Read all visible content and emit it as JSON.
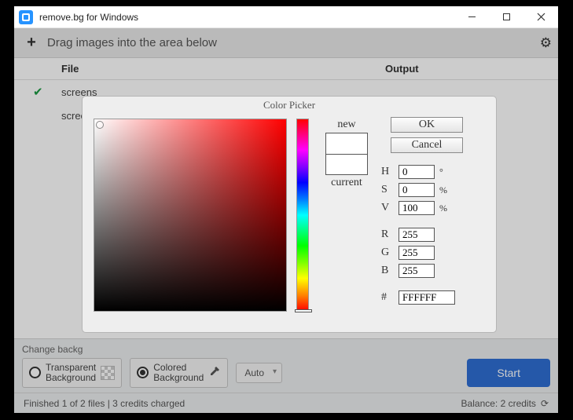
{
  "titlebar": {
    "title": "remove.bg for Windows"
  },
  "toolbar": {
    "drag_hint": "Drag images into the area below"
  },
  "columns": {
    "file": "File",
    "output": "Output"
  },
  "rows": [
    {
      "status": "done",
      "file": "screens"
    },
    {
      "status": "",
      "file": "screens"
    }
  ],
  "bottom": {
    "change_label": "Change backg",
    "transparent": "Transparent\nBackground",
    "colored": "Colored\nBackground",
    "size": "Auto",
    "start": "Start"
  },
  "status": {
    "left": "Finished 1 of 2 files | 3 credits charged",
    "right": "Balance: 2 credits"
  },
  "dialog": {
    "title": "Color Picker",
    "new": "new",
    "current": "current",
    "ok": "OK",
    "cancel": "Cancel",
    "fields": {
      "H_label": "H",
      "H": "0",
      "H_unit": "°",
      "S_label": "S",
      "S": "0",
      "S_unit": "%",
      "V_label": "V",
      "V": "100",
      "V_unit": "%",
      "R_label": "R",
      "R": "255",
      "G_label": "G",
      "G": "255",
      "B_label": "B",
      "B": "255",
      "hex_label": "#",
      "hex": "FFFFFF"
    }
  }
}
